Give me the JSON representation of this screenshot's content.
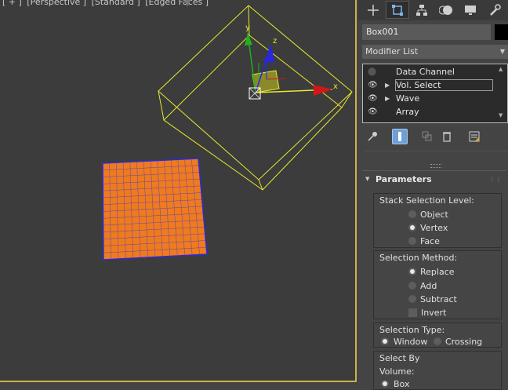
{
  "viewport": {
    "labels": [
      "[ + ]",
      "[Perspective ]",
      "[Standard ]",
      "[Edged Faces ]"
    ],
    "gizmo": {
      "x_label": "x",
      "y_label": "y",
      "z_label": "z"
    }
  },
  "panel": {
    "tabs": [
      "create-icon",
      "modify-icon",
      "hierarchy-icon",
      "motion-icon",
      "display-icon",
      "utilities-icon"
    ],
    "object_name": "Box001",
    "object_color": "#000000",
    "modifier_list_label": "Modifier List",
    "stack": [
      {
        "label": "Data Channel",
        "visible": false,
        "expandable": false
      },
      {
        "label": "Vol. Select",
        "visible": true,
        "expandable": true,
        "selected": true
      },
      {
        "label": "Wave",
        "visible": true,
        "expandable": true
      },
      {
        "label": "Array",
        "visible": true,
        "expandable": false
      }
    ],
    "toolbar": [
      "pin-stack-icon",
      "show-end-result-icon",
      "make-unique-icon",
      "remove-modifier-icon",
      "configure-sets-icon"
    ],
    "rollout": {
      "title": "Parameters",
      "stack_level": {
        "label": "Stack Selection Level:",
        "options": [
          "Object",
          "Vertex",
          "Face"
        ],
        "selected": "Vertex"
      },
      "selection_method": {
        "label": "Selection Method:",
        "options": [
          "Replace",
          "Add",
          "Subtract"
        ],
        "selected": "Replace",
        "invert_label": "Invert",
        "invert_checked": false
      },
      "selection_type": {
        "label": "Selection Type:",
        "options": [
          "Window",
          "Crossing"
        ],
        "selected": "Window"
      },
      "select_by": {
        "label": "Select By",
        "volume_label": "Volume:",
        "volume_option": "Box",
        "volume_selected": true
      }
    }
  },
  "colors": {
    "viewport_bg": "#3c3c3c",
    "active_border": "#c8b34a",
    "box_wire": "#e8e830",
    "plane_fill": "#f07a1e",
    "plane_wire": "#2a2ae0",
    "axis_x": "#d01818",
    "axis_y": "#20b020",
    "axis_z": "#2828d8"
  }
}
